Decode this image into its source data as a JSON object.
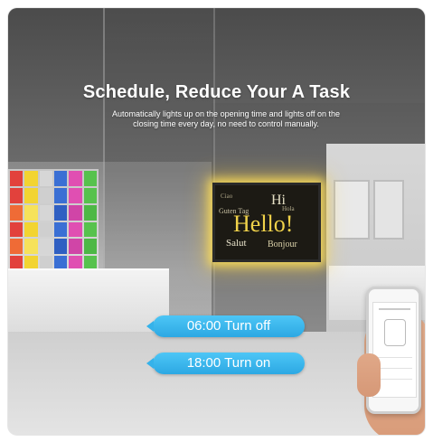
{
  "headline": "Schedule, Reduce Your A Task",
  "subtext": "Automatically lights up on the opening time and lights off on the closing time every day, no need to control manually.",
  "schedule": [
    {
      "label": "06:00 Turn off"
    },
    {
      "label": "18:00 Turn on"
    }
  ],
  "tv_words": {
    "hello": "Hello!",
    "hi": "Hi",
    "guten": "Guten Tag",
    "salut": "Salut",
    "bonjour": "Bonjour",
    "hola": "Hola",
    "ciao": "Ciao"
  },
  "colors": {
    "pill": "#2ca8e3",
    "glow": "#ffe15a"
  }
}
